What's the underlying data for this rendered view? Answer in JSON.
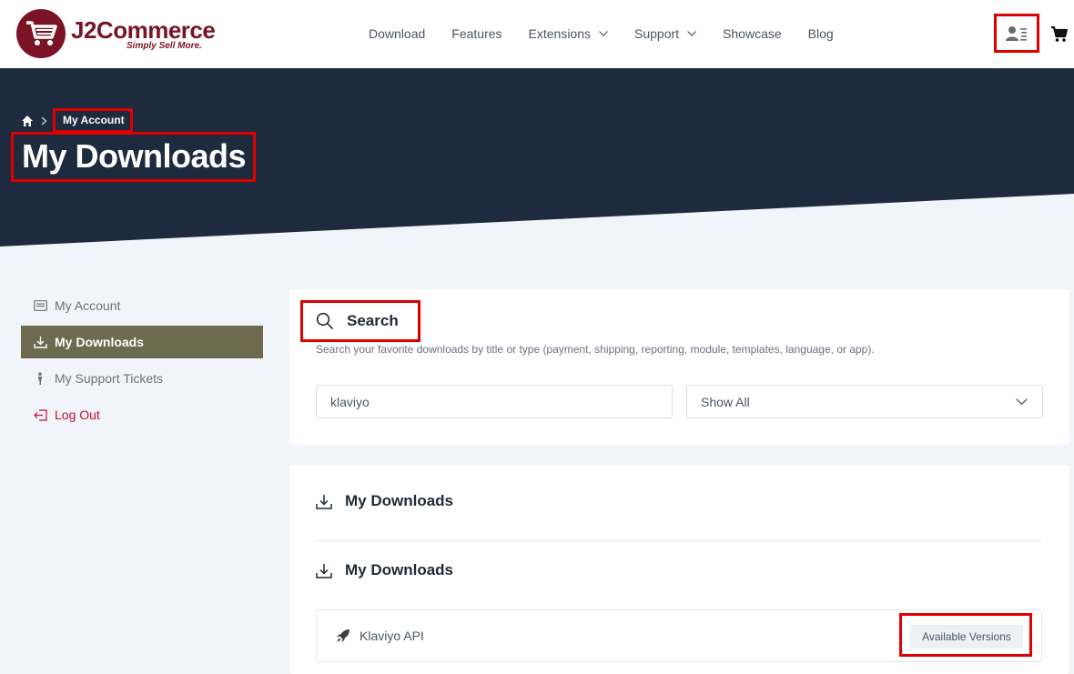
{
  "brand": {
    "name": "J2Commerce",
    "tagline": "Simply Sell More.",
    "color": "#7b1326"
  },
  "nav": {
    "items": [
      {
        "label": "Download",
        "dropdown": false
      },
      {
        "label": "Features",
        "dropdown": false
      },
      {
        "label": "Extensions",
        "dropdown": true
      },
      {
        "label": "Support",
        "dropdown": true
      },
      {
        "label": "Showcase",
        "dropdown": false
      },
      {
        "label": "Blog",
        "dropdown": false
      }
    ],
    "icons": [
      "user-menu-icon",
      "cart-icon"
    ]
  },
  "hero": {
    "breadcrumb": "My Account",
    "title": "My Downloads",
    "bg_color": "#1e2a3d"
  },
  "sidebar": {
    "items": [
      {
        "label": "My Account",
        "icon": "account-card-icon",
        "active": false
      },
      {
        "label": "My Downloads",
        "icon": "download-icon",
        "active": true
      },
      {
        "label": "My Support Tickets",
        "icon": "person-icon",
        "active": false
      },
      {
        "label": "Log Out",
        "icon": "logout-icon",
        "active": false
      }
    ],
    "active_color": "#6e6a4f",
    "logout_color": "#c8102e"
  },
  "search": {
    "heading": "Search",
    "description": "Search your favorite downloads by title or type (payment, shipping, reporting, module, templates, language, or app).",
    "input_value": "klaviyo",
    "filter_value": "Show All"
  },
  "downloads": {
    "heading_1": "My Downloads",
    "heading_2": "My Downloads",
    "items": [
      {
        "name": "Klaviyo API",
        "icon": "rocket-icon",
        "action": "Available Versions"
      }
    ]
  },
  "highlight_color": "#e00000"
}
